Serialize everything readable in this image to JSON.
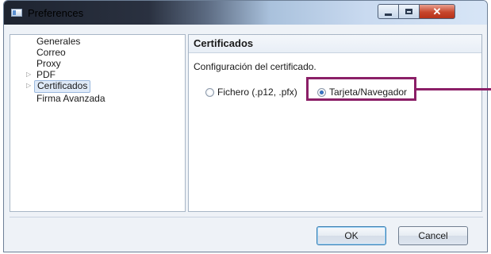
{
  "window": {
    "title": "Preferences"
  },
  "sidebar": {
    "items": [
      {
        "label": "Generales",
        "expandable": false,
        "selected": false
      },
      {
        "label": "Correo",
        "expandable": false,
        "selected": false
      },
      {
        "label": "Proxy",
        "expandable": false,
        "selected": false
      },
      {
        "label": "PDF",
        "expandable": true,
        "selected": false
      },
      {
        "label": "Certificados",
        "expandable": true,
        "selected": true
      },
      {
        "label": "Firma Avanzada",
        "expandable": false,
        "selected": false
      }
    ]
  },
  "main": {
    "title": "Certificados",
    "description": "Configuración del certificado.",
    "radio_options": [
      {
        "label": "Fichero (.p12, .pfx)",
        "checked": false
      },
      {
        "label": "Tarjeta/Navegador",
        "checked": true
      }
    ]
  },
  "buttons": {
    "ok": "OK",
    "cancel": "Cancel"
  },
  "colors": {
    "highlight": "#8b1f67",
    "selection": "#dfeaf8",
    "close_button": "#c7462c"
  }
}
